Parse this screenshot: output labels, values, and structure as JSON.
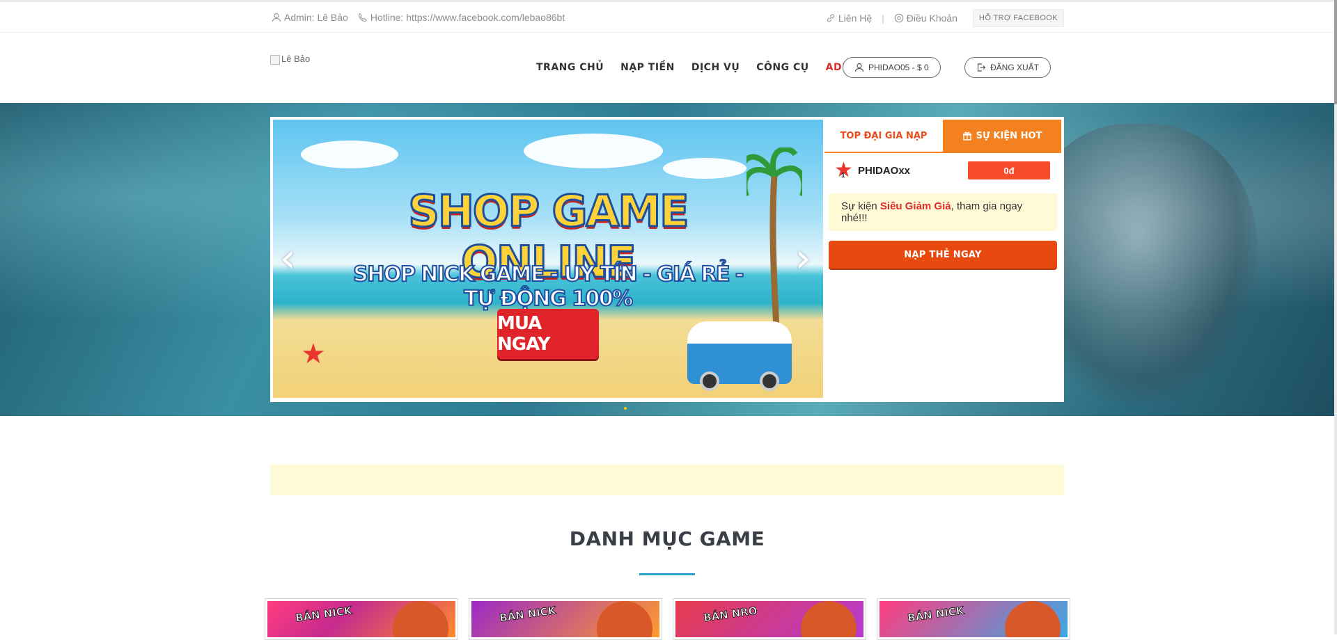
{
  "topbar": {
    "admin": "Admin: Lê Bảo",
    "hotline": "Hotline: https://www.facebook.com/lebao86bt",
    "contact": "Liên Hệ",
    "separator": "|",
    "terms": "Điều Khoản",
    "support": "HỖ TRỢ FACEBOOK"
  },
  "header": {
    "logo_alt": "Lê Bảo",
    "nav": [
      "TRANG CHỦ",
      "NẠP TIỀN",
      "DỊCH VỤ",
      "CÔNG CỤ",
      "ADMIN"
    ],
    "account": "PHIDAO05 - $ 0",
    "logout": "ĐĂNG XUẤT"
  },
  "banner": {
    "title": "SHOP GAME ONLINE",
    "subtitle": "SHOP NICK GAME - UY TÍN - GIÁ RẺ - TỰ ĐỘNG 100%",
    "button": "MUA NGAY",
    "prev": "‹",
    "next": "›"
  },
  "panel": {
    "tab_top": "TOP ĐẠI GIA NẠP",
    "tab_hot": "SỰ KIỆN HOT",
    "rank": {
      "position": "1",
      "name": "PHIDAOxx",
      "amount": "0đ"
    },
    "event_prefix": "Sự kiện ",
    "event_highlight": "Siêu Giảm Giá",
    "event_suffix": ", tham gia ngay nhé!!!",
    "cta": "NẠP THẺ NGAY"
  },
  "section": {
    "title": "DANH MỤC GAME"
  },
  "cards": [
    {
      "label": "BÁN NICK"
    },
    {
      "label": "BÁN NICK"
    },
    {
      "label": "BÁN NRO"
    },
    {
      "label": "BÁN NICK"
    }
  ],
  "colors": {
    "accent_orange": "#f4811f",
    "cta_orange": "#e8490f",
    "admin_red": "#e02d2d",
    "section_line": "#2aa0c4",
    "notice_bg": "#fffbd6"
  },
  "icons": [
    "user-icon",
    "phone-icon",
    "link-icon",
    "info-icon",
    "gift-icon",
    "logout-icon",
    "star-icon",
    "chevron-left-icon",
    "chevron-right-icon"
  ]
}
